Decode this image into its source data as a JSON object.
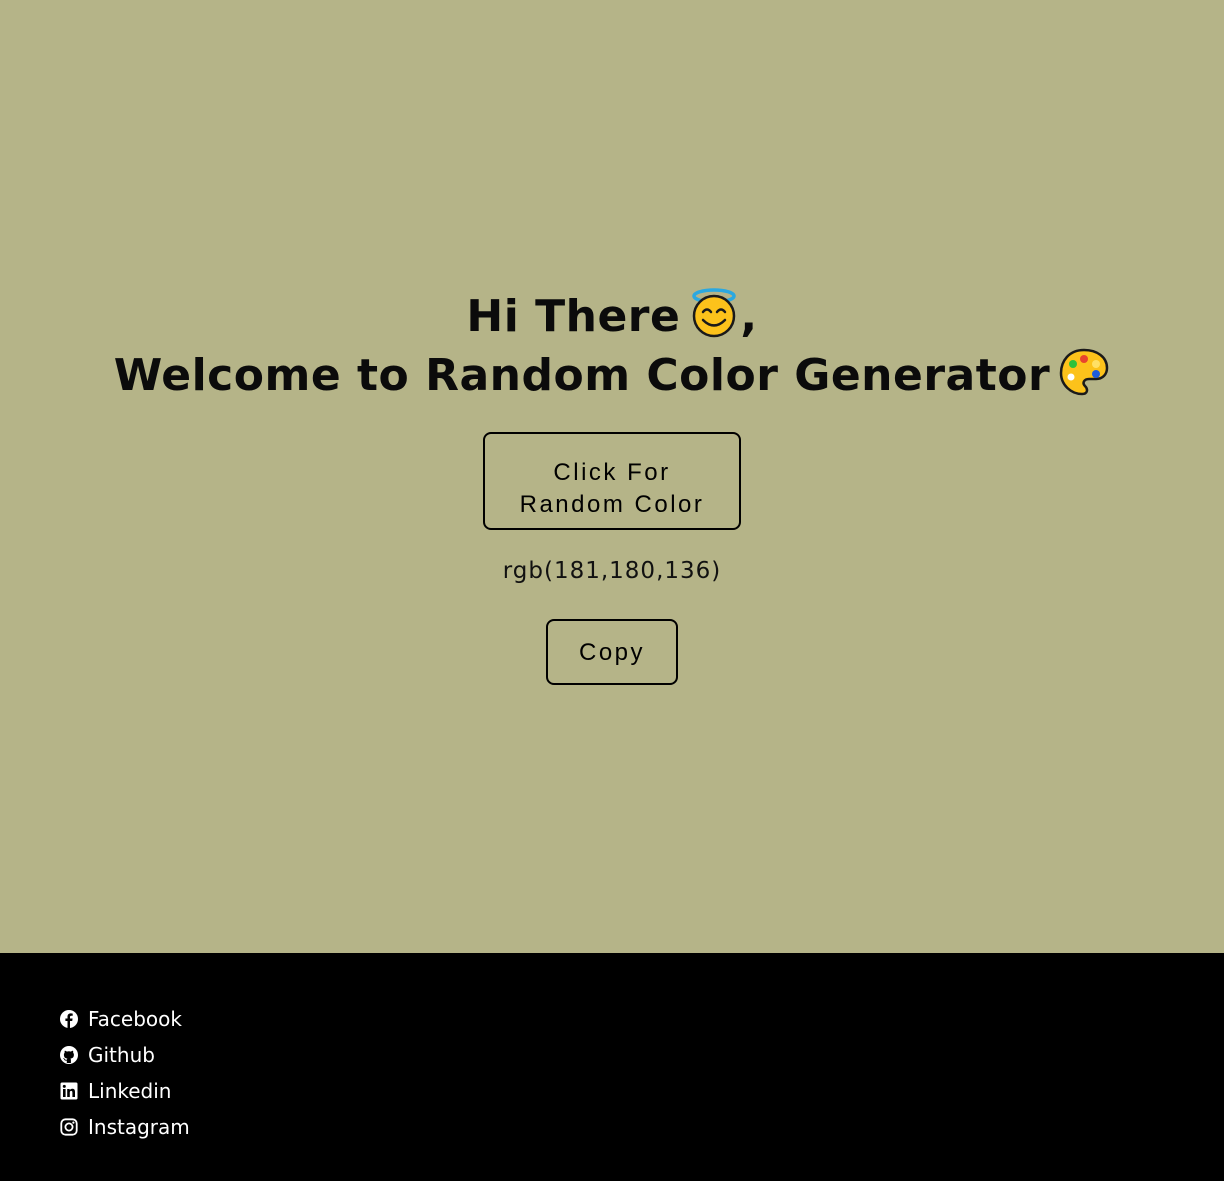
{
  "theme": {
    "background": "#b5b488",
    "footer_background": "#000000",
    "text": "#0b0b0b",
    "footer_text": "#ffffff"
  },
  "hero": {
    "line1": "Hi There",
    "line1_icon": "smiling-face-with-halo-icon",
    "line1_suffix": ",",
    "line2": "Welcome to Random Color Generator",
    "line2_icon": "artist-palette-icon"
  },
  "random_button": {
    "line1": "Click For",
    "line2": "Random Color"
  },
  "current_color": "rgb(181,180,136)",
  "copy_button": "Copy",
  "footer": {
    "links": [
      {
        "label": "Facebook",
        "icon": "facebook-icon"
      },
      {
        "label": "Github",
        "icon": "github-icon"
      },
      {
        "label": "Linkedin",
        "icon": "linkedin-icon"
      },
      {
        "label": "Instagram",
        "icon": "instagram-icon"
      }
    ]
  }
}
